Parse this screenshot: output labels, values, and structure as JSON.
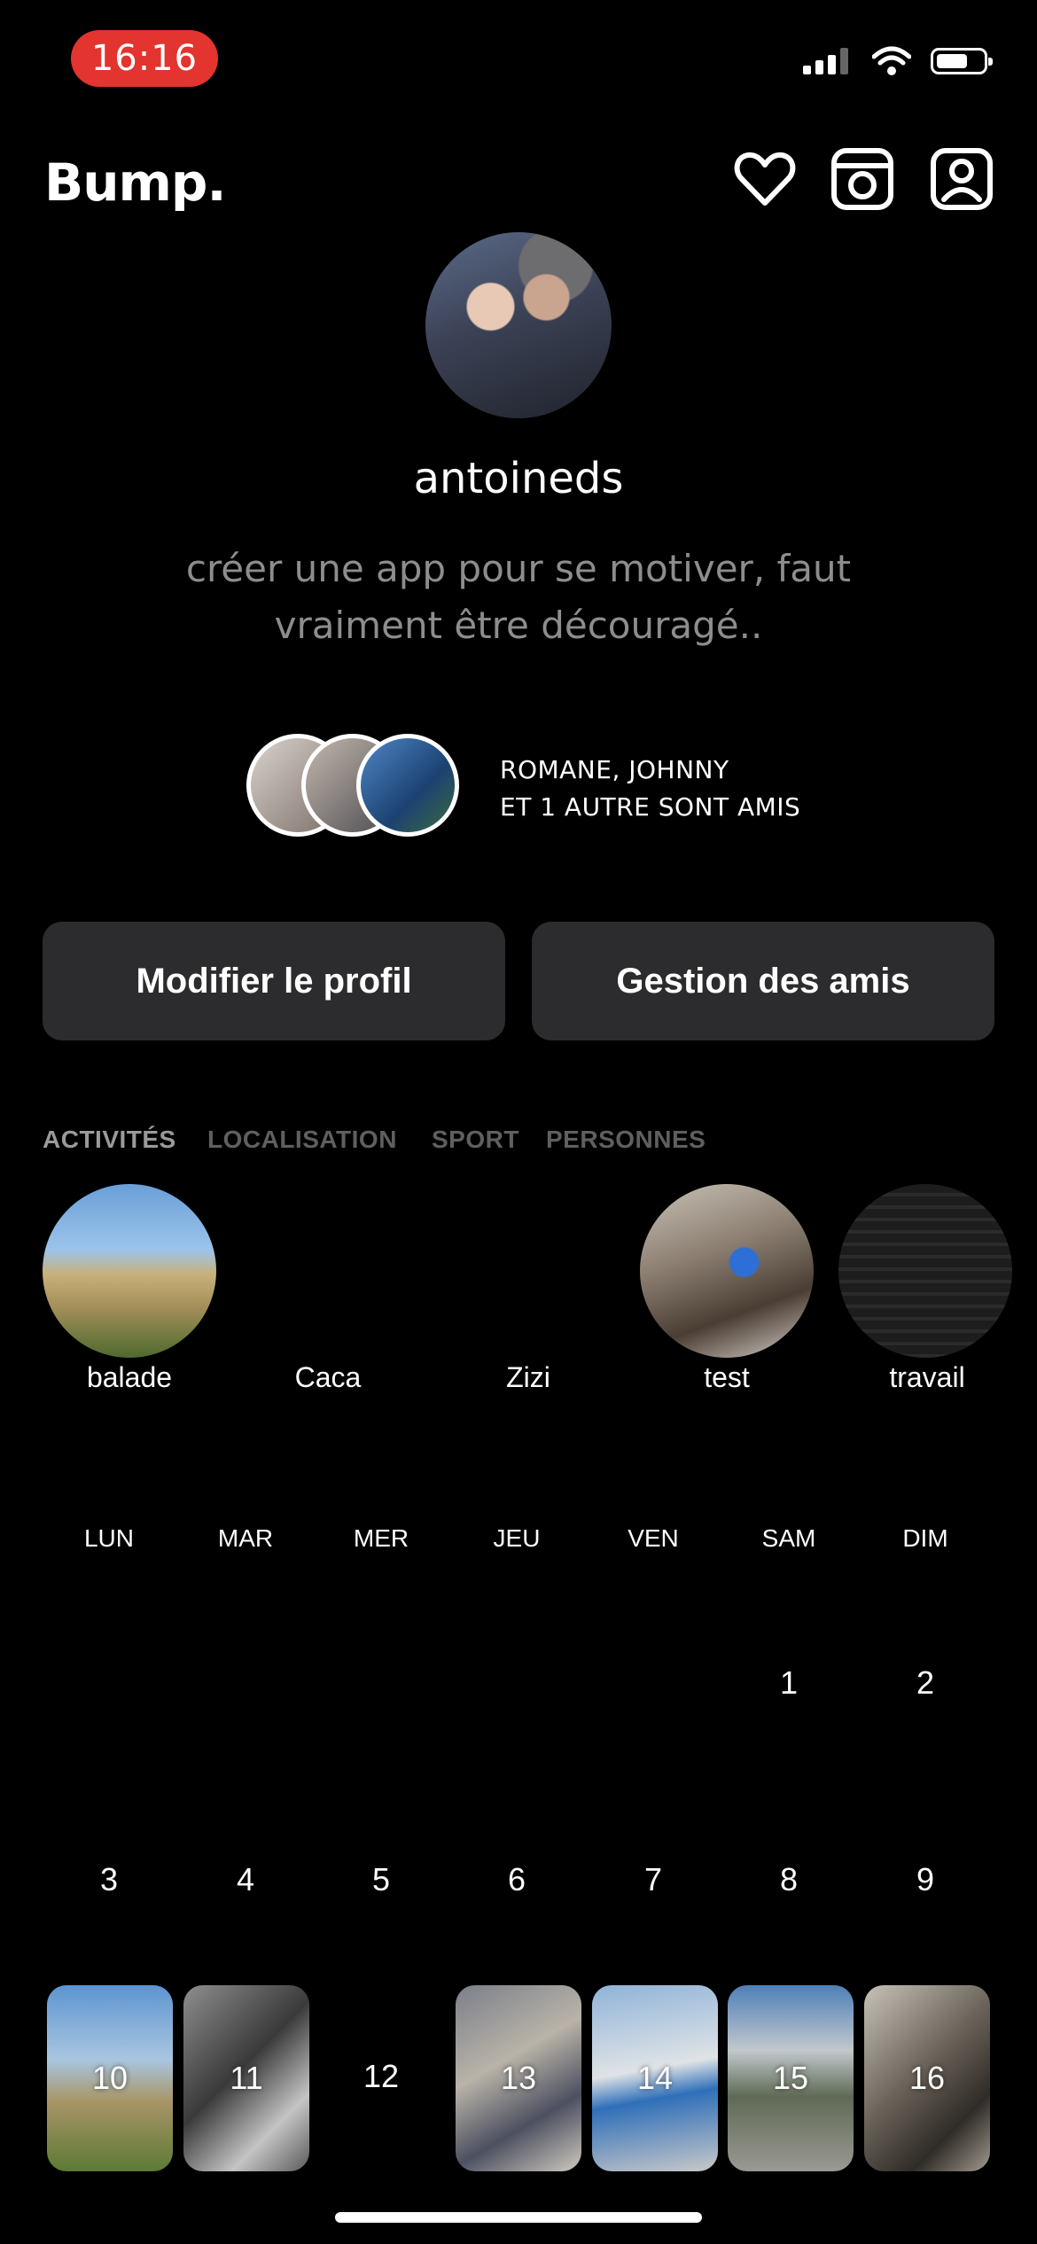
{
  "status_bar": {
    "time": "16:16"
  },
  "header": {
    "brand": "Bump.",
    "icons": [
      "heart-icon",
      "camera-icon",
      "profile-icon"
    ]
  },
  "profile": {
    "username": "antoineds",
    "bio": "créer une app pour se motiver, faut vraiment être découragé..",
    "friends_line1": "ROMANE, JOHNNY",
    "friends_line2": "ET 1 AUTRE SONT AMIS"
  },
  "buttons": {
    "edit_profile": "Modifier le profil",
    "manage_friends": "Gestion des amis"
  },
  "tabs": [
    {
      "label": "ACTIVITÉS",
      "active": true
    },
    {
      "label": "LOCALISATION",
      "active": false
    },
    {
      "label": "SPORT",
      "active": false
    },
    {
      "label": "PERSONNES",
      "active": false
    }
  ],
  "activities": [
    {
      "label": "balade"
    },
    {
      "label": "Caca"
    },
    {
      "label": "Zizi"
    },
    {
      "label": "test"
    },
    {
      "label": "travail"
    }
  ],
  "calendar": {
    "weekdays": [
      "LUN",
      "MAR",
      "MER",
      "JEU",
      "VEN",
      "SAM",
      "DIM"
    ],
    "week1": [
      "1",
      "2"
    ],
    "week2": [
      "3",
      "4",
      "5",
      "6",
      "7",
      "8",
      "9"
    ],
    "week3": [
      "10",
      "11",
      "12",
      "13",
      "14",
      "15",
      "16"
    ]
  }
}
